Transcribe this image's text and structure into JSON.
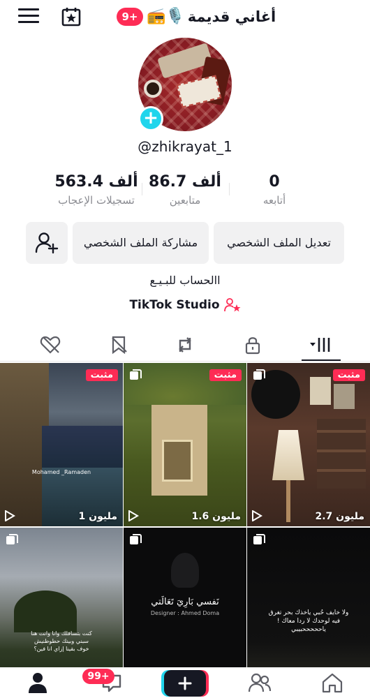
{
  "header": {
    "title": "أغاني قديمة",
    "title_emoji": "📻🎙️",
    "notif_badge": "9+"
  },
  "profile": {
    "username": "@zhikrayat_1",
    "bio": "االحساب للبـيـع",
    "studio_label": "TikTok Studio"
  },
  "stats": {
    "likes_value": "563.4 ألف",
    "likes_label": "تسجيلات الإعجاب",
    "followers_value": "86.7 ألف",
    "followers_label": "متابعين",
    "following_value": "0",
    "following_label": "أتابعه"
  },
  "buttons": {
    "edit_profile": "تعديل الملف الشخصي",
    "share_profile": "مشاركة الملف الشخصي"
  },
  "videos": [
    {
      "pinned": "مثبت",
      "views": "1 مليون",
      "overlay": "Mohamed _Ramaden"
    },
    {
      "pinned": "مثبت",
      "views": "1.6 مليون",
      "overlay": ""
    },
    {
      "pinned": "مثبت",
      "views": "2.7 مليون",
      "overlay": ""
    },
    {
      "pinned": "",
      "views": "",
      "overlay": "كنت بتسافلك وانا وانت هنا سبني وبينك حطوطنيش خوف بقينا إزاي انا فين؟"
    },
    {
      "pinned": "",
      "views": "",
      "overlay": "نَفسي بَارِيَ تَعَالَتي"
    },
    {
      "pinned": "",
      "views": "",
      "overlay": "ولا خايف حُبي ياخذك بحر تغرق فيه لوحدك لا ردا معاك ! ياحححححبيبي"
    }
  ],
  "video4_signature": "Designer : Ahmed Doma",
  "bottom_nav": {
    "inbox_badge": "99+"
  },
  "colors": {
    "accent_red": "#fe2c55",
    "accent_cyan": "#20d5ec",
    "button_bg": "#f1f1f2"
  },
  "icons": {
    "menu": "hamburger-icon",
    "calendar": "calendar-star-icon",
    "add_friend": "add-friend-icon",
    "grid_tab": "videos-grid-icon",
    "lock_tab": "lock-icon",
    "repost_tab": "repost-icon",
    "saved_tab": "bookmark-icon",
    "liked_tab": "liked-heart-icon"
  }
}
